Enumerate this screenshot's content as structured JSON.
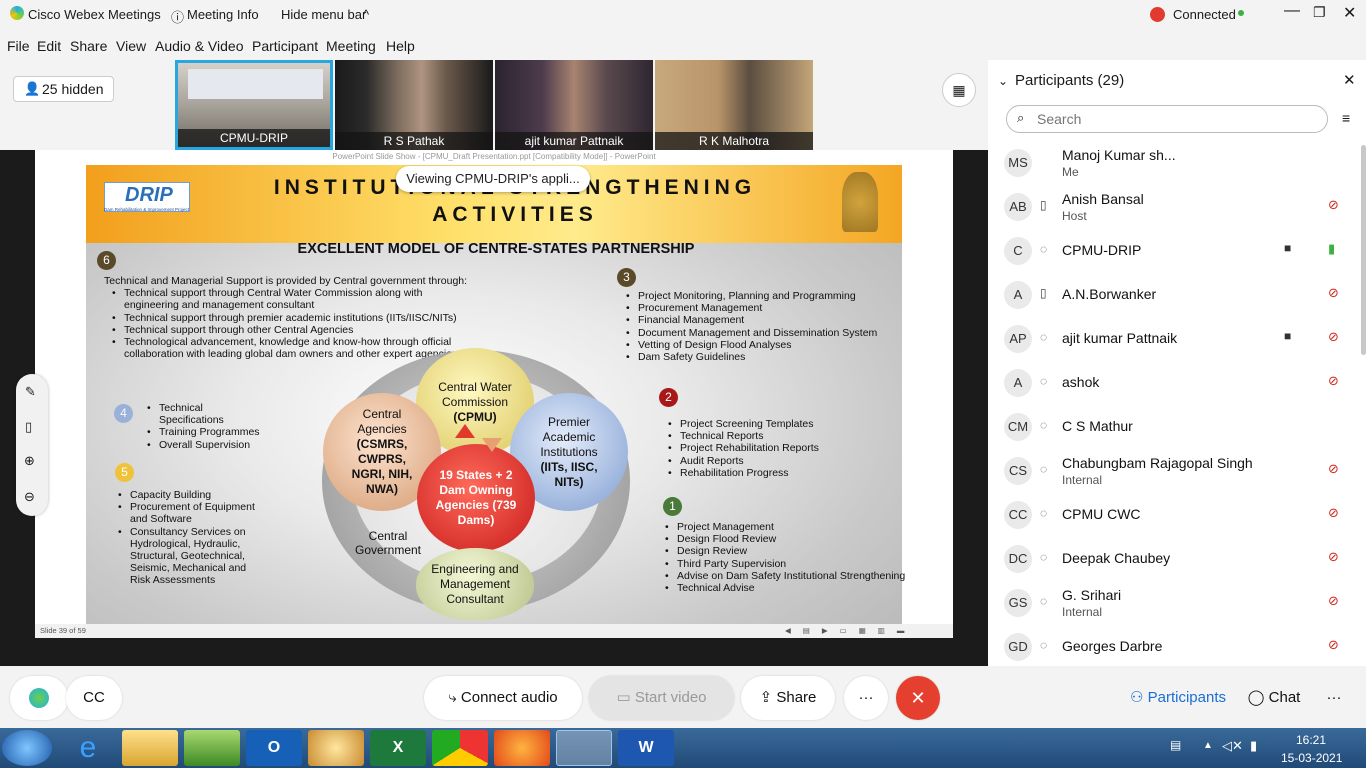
{
  "window": {
    "app_title": "Cisco Webex Meetings",
    "meeting_info": "Meeting Info",
    "hide_menu": "Hide menu bar",
    "status": "Connected"
  },
  "menu": [
    "File",
    "Edit",
    "Share",
    "View",
    "Audio & Video",
    "Participant",
    "Meeting",
    "Help"
  ],
  "hidden_count": "25 hidden",
  "videos": [
    {
      "name": "CPMU-DRIP"
    },
    {
      "name": "R S Pathak"
    },
    {
      "name": "ajit kumar Pattnaik"
    },
    {
      "name": "R K Malhotra"
    }
  ],
  "share_banner": "Viewing CPMU-DRIP's appli...",
  "ppt": {
    "window_title": "PowerPoint Slide Show - [CPMU_Draft Presentation.ppt [Compatibility Mode]] - PowerPoint",
    "slide_counter": "Slide 39 of 59",
    "logo": "DRIP",
    "logo_sub": "Dam Rehabilitation & Improvement Project",
    "title_line1": "INSTITUTIONAL STRENGTHENING",
    "title_line2": "ACTIVITIES",
    "subtitle": "EXCELLENT MODEL OF CENTRE-STATES PARTNERSHIP",
    "s6_intro": "Technical and Managerial Support is provided by Central government through:",
    "s6_items": [
      "Technical support through Central Water Commission along with engineering and management consultant",
      "Technical support through premier academic institutions (IITs/IISC/NITs)",
      "Technical support through other Central Agencies",
      "Technological advancement, knowledge and know-how through official collaboration with leading global dam owners and other expert agencies"
    ],
    "s4_items": [
      "Technical Specifications",
      "Training Programmes",
      "Overall Supervision"
    ],
    "s5_items": [
      "Capacity Building",
      "Procurement of Equipment and Software",
      "Consultancy Services on Hydrological, Hydraulic, Structural, Geotechnical, Seismic, Mechanical and Risk Assessments"
    ],
    "s3_items": [
      "Project Monitoring, Planning and Programming",
      "Procurement Management",
      "Financial Management",
      "Document Management and Dissemination System",
      "Vetting of Design Flood Analyses",
      "Dam Safety Guidelines"
    ],
    "s2_items": [
      "Project Screening Templates",
      "Technical Reports",
      "Project Rehabilitation Reports",
      "Audit Reports",
      "Rehabilitation Progress"
    ],
    "s1_items": [
      "Project Management",
      "Design Flood Review",
      "Design Review",
      "Third Party Supervision",
      "Advise on Dam Safety Institutional Strengthening",
      "Technical Advise"
    ],
    "circles": {
      "cwc_top": "Central Water Commission",
      "cwc_bold": "(CPMU)",
      "central_top": "Central Agencies",
      "central_bold": "(CSMRS, CWPRS, NGRI, NIH, NWA)",
      "premier_top": "Premier Academic Institutions",
      "premier_bold": "(IITs, IISC, NITs)",
      "states": "19 States + 2 Dam Owning Agencies (739 Dams)",
      "emc": "Engineering and Management Consultant",
      "govt": "Central Government"
    },
    "nums": [
      "6",
      "3",
      "4",
      "5",
      "2",
      "1"
    ]
  },
  "panel": {
    "title": "Participants (29)",
    "search_placeholder": "Search",
    "participants": [
      {
        "initials": "MS",
        "name": "Manoj Kumar sh...",
        "sub": "Me"
      },
      {
        "initials": "AB",
        "name": "Anish Bansal",
        "sub": "Host"
      },
      {
        "initials": "C",
        "name": "CPMU-DRIP",
        "sub": ""
      },
      {
        "initials": "A",
        "name": "A.N.Borwanker",
        "sub": ""
      },
      {
        "initials": "AP",
        "name": "ajit kumar Pattnaik",
        "sub": ""
      },
      {
        "initials": "A",
        "name": "ashok",
        "sub": ""
      },
      {
        "initials": "CM",
        "name": "C S Mathur",
        "sub": ""
      },
      {
        "initials": "CS",
        "name": "Chabungbam Rajagopal Singh",
        "sub": "Internal"
      },
      {
        "initials": "CC",
        "name": "CPMU CWC",
        "sub": ""
      },
      {
        "initials": "DC",
        "name": "Deepak Chaubey",
        "sub": ""
      },
      {
        "initials": "GS",
        "name": "G. Srihari",
        "sub": "Internal"
      },
      {
        "initials": "GD",
        "name": "Georges Darbre",
        "sub": ""
      }
    ]
  },
  "controls": {
    "connect_audio": "Connect audio",
    "start_video": "Start video",
    "share": "Share",
    "more": "···",
    "participants": "Participants",
    "chat": "Chat"
  },
  "clock": {
    "time": "16:21",
    "date": "15-03-2021"
  }
}
